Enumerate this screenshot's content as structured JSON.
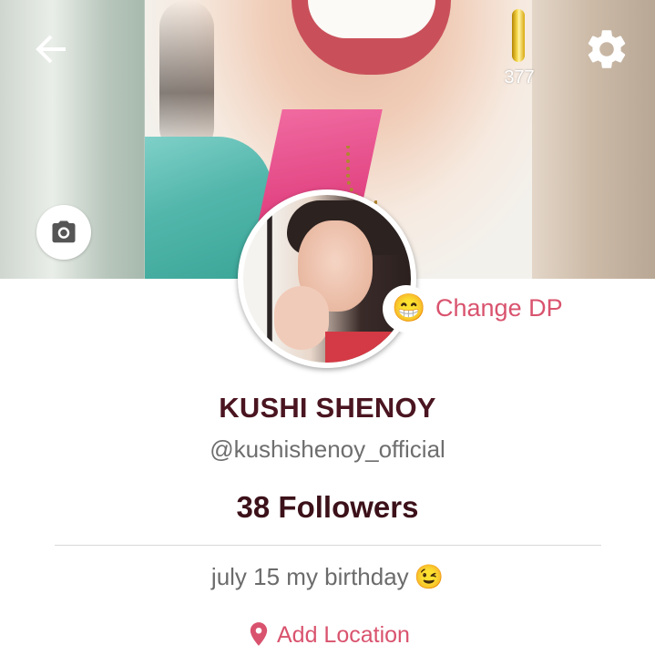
{
  "header": {
    "back_icon": "arrow-left-icon",
    "settings_icon": "gear-icon",
    "coin_icon": "gold-coin-icon",
    "coin_count": "377"
  },
  "cover": {
    "camera_icon": "camera-icon"
  },
  "profile": {
    "change_dp_emoji": "😁",
    "change_dp_label": "Change DP",
    "name": "KUSHI SHENOY",
    "handle": "@kushishenoy_official",
    "followers": "38 Followers",
    "bio": "july 15 my birthday",
    "bio_emoji": "😉",
    "location_icon": "map-pin-icon",
    "add_location_label": "Add Location"
  },
  "colors": {
    "accent": "#d9536e",
    "name_color": "#4a1520",
    "followers_color": "#3c1119",
    "muted_text": "#6b6b6b"
  }
}
